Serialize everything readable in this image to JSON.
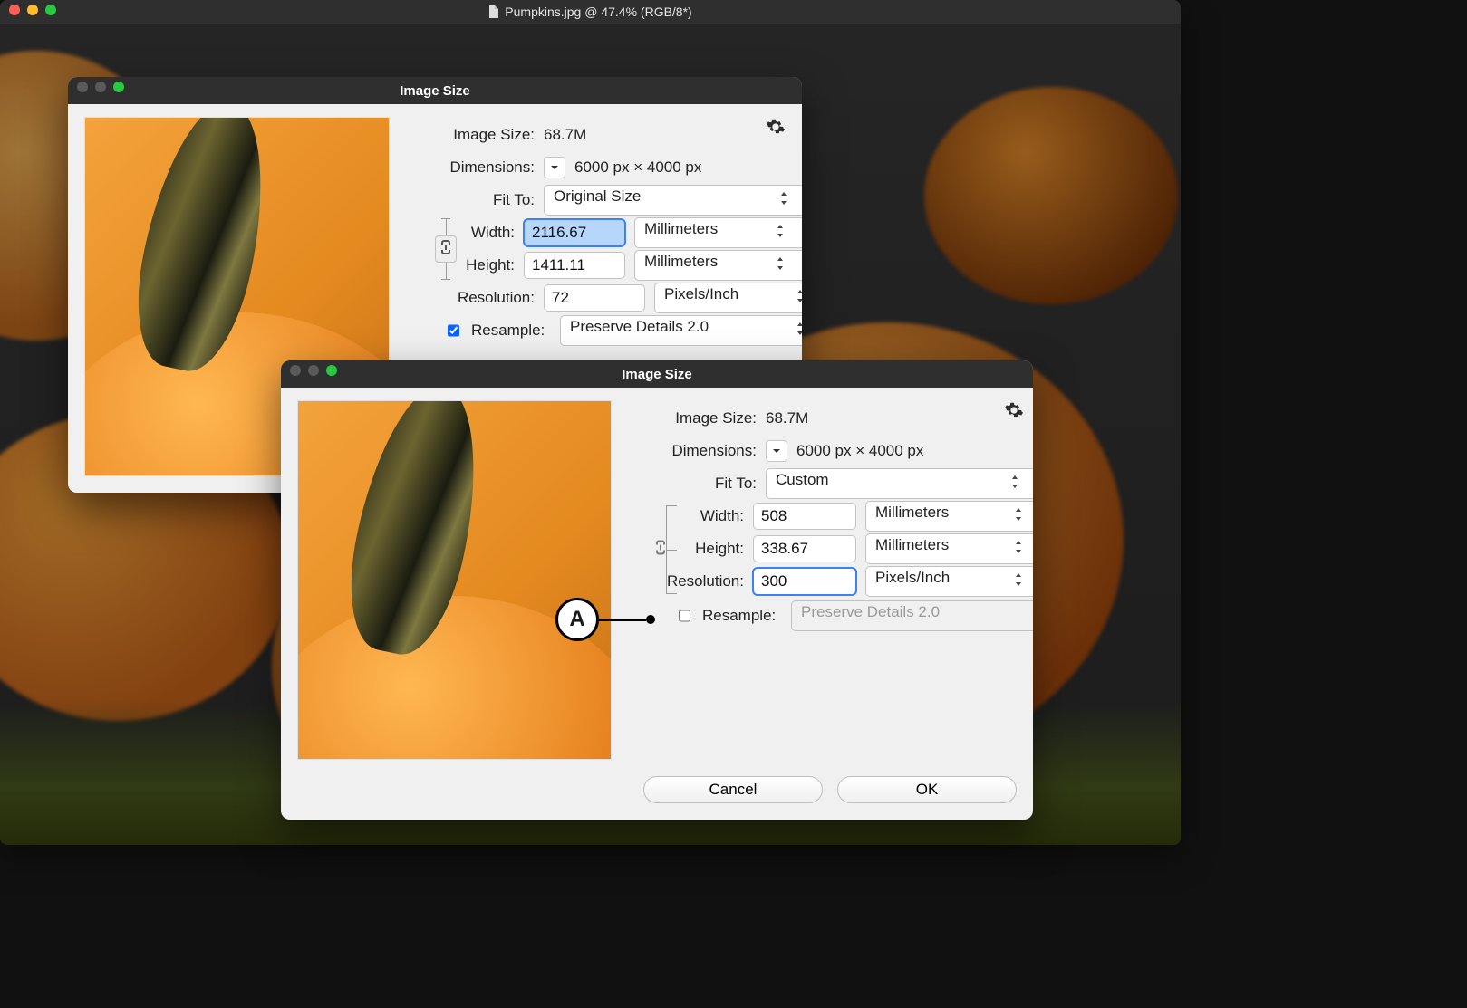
{
  "doc": {
    "title": "Pumpkins.jpg @ 47.4% (RGB/8*)"
  },
  "dialogs": {
    "back": {
      "title": "Image Size",
      "image_size_label": "Image Size:",
      "image_size_value": "68.7M",
      "dimensions_label": "Dimensions:",
      "dimensions_value": "6000 px  ×  4000 px",
      "fit_to_label": "Fit To:",
      "fit_to_value": "Original Size",
      "width_label": "Width:",
      "width_value": "2116.67",
      "width_unit": "Millimeters",
      "height_label": "Height:",
      "height_value": "1411.11",
      "height_unit": "Millimeters",
      "resolution_label": "Resolution:",
      "resolution_value": "72",
      "resolution_unit": "Pixels/Inch",
      "resample_label": "Resample:",
      "resample_checked": true,
      "resample_value": "Preserve Details 2.0"
    },
    "front": {
      "title": "Image Size",
      "image_size_label": "Image Size:",
      "image_size_value": "68.7M",
      "dimensions_label": "Dimensions:",
      "dimensions_value": "6000 px  ×  4000 px",
      "fit_to_label": "Fit To:",
      "fit_to_value": "Custom",
      "width_label": "Width:",
      "width_value": "508",
      "width_unit": "Millimeters",
      "height_label": "Height:",
      "height_value": "338.67",
      "height_unit": "Millimeters",
      "resolution_label": "Resolution:",
      "resolution_value": "300",
      "resolution_unit": "Pixels/Inch",
      "resample_label": "Resample:",
      "resample_checked": false,
      "resample_value": "Preserve Details 2.0",
      "cancel_label": "Cancel",
      "ok_label": "OK"
    }
  },
  "callout": {
    "letter": "A"
  }
}
